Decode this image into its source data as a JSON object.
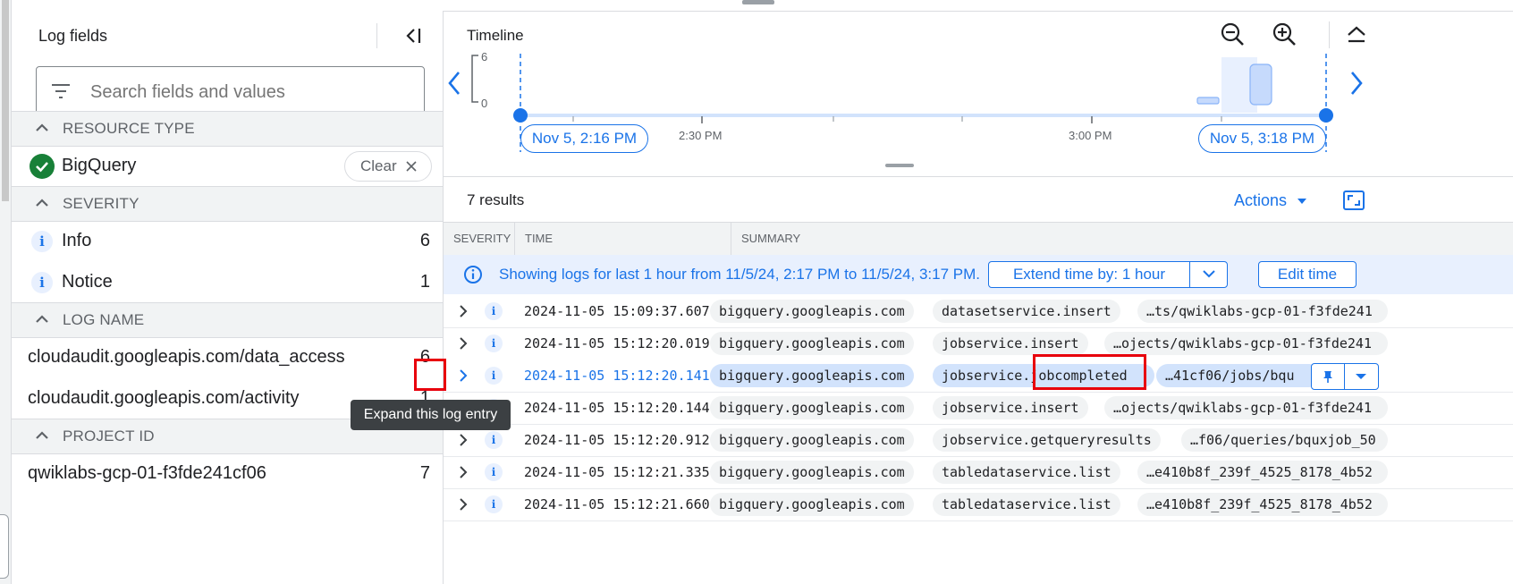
{
  "left_panel": {
    "title": "Log fields",
    "search_placeholder": "Search fields and values",
    "sections": {
      "resource_type": {
        "label": "RESOURCE TYPE",
        "selected": "BigQuery",
        "clear_label": "Clear"
      },
      "severity": {
        "label": "SEVERITY",
        "items": [
          {
            "name": "Info",
            "count": "6"
          },
          {
            "name": "Notice",
            "count": "1"
          }
        ]
      },
      "log_name": {
        "label": "LOG NAME",
        "items": [
          {
            "name": "cloudaudit.googleapis.com/data_access",
            "count": "6"
          },
          {
            "name": "cloudaudit.googleapis.com/activity",
            "count": "1"
          }
        ]
      },
      "project_id": {
        "label": "PROJECT ID",
        "items": [
          {
            "name": "qwiklabs-gcp-01-f3fde241cf06",
            "count": "7"
          }
        ]
      }
    }
  },
  "timeline": {
    "title": "Timeline",
    "y_max": "6",
    "y_min": "0",
    "start_label": "Nov 5, 2:16 PM",
    "end_label": "Nov 5, 3:18 PM",
    "tick_labels": [
      "2:30 PM",
      "3:00 PM"
    ]
  },
  "results": {
    "count_label": "7 results",
    "actions_label": "Actions",
    "columns": {
      "severity": "SEVERITY",
      "time": "TIME",
      "summary": "SUMMARY"
    },
    "banner": {
      "text": "Showing logs for last 1 hour from 11/5/24, 2:17 PM to 11/5/24, 3:17 PM.",
      "extend_label": "Extend time by: 1 hour",
      "edit_label": "Edit time"
    },
    "rows": [
      {
        "time": "2024-11-05 15:09:37.607",
        "service": "bigquery.googleapis.com",
        "method": "datasetservice.insert",
        "resource": "…ts/qwiklabs-gcp-01-f3fde241"
      },
      {
        "time": "2024-11-05 15:12:20.019",
        "service": "bigquery.googleapis.com",
        "method": "jobservice.insert",
        "resource": "…ojects/qwiklabs-gcp-01-f3fde241"
      },
      {
        "time": "2024-11-05 15:12:20.141",
        "service": "bigquery.googleapis.com",
        "method_a": "jobservice.",
        "method_b": "jobcompleted",
        "resource": "…41cf06/jobs/bqu"
      },
      {
        "time": "2024-11-05 15:12:20.144",
        "service": "bigquery.googleapis.com",
        "method": "jobservice.insert",
        "resource": "…ojects/qwiklabs-gcp-01-f3fde241"
      },
      {
        "time": "2024-11-05 15:12:20.912",
        "service": "bigquery.googleapis.com",
        "method": "jobservice.getqueryresults",
        "resource": "…f06/queries/bquxjob_50"
      },
      {
        "time": "2024-11-05 15:12:21.335",
        "service": "bigquery.googleapis.com",
        "method": "tabledataservice.list",
        "resource": "…e410b8f_239f_4525_8178_4b52"
      },
      {
        "time": "2024-11-05 15:12:21.660",
        "service": "bigquery.googleapis.com",
        "method": "tabledataservice.list",
        "resource": "…e410b8f_239f_4525_8178_4b52"
      }
    ]
  },
  "tooltip": "Expand this log entry",
  "icons": {
    "filter": "filter-icon",
    "collapse": "collapse-panel-icon",
    "zoom_out": "zoom-out-icon",
    "zoom_in": "zoom-in-icon",
    "collapse_timeline": "chevron-up-icon",
    "expand_view": "expand-view-icon",
    "pin": "pin-icon",
    "menu": "dropdown-icon",
    "check": "check-circle-icon",
    "info": "info-icon"
  },
  "colors": {
    "accent": "#1a73e8",
    "success": "#188038",
    "highlight": "#e8000c"
  }
}
